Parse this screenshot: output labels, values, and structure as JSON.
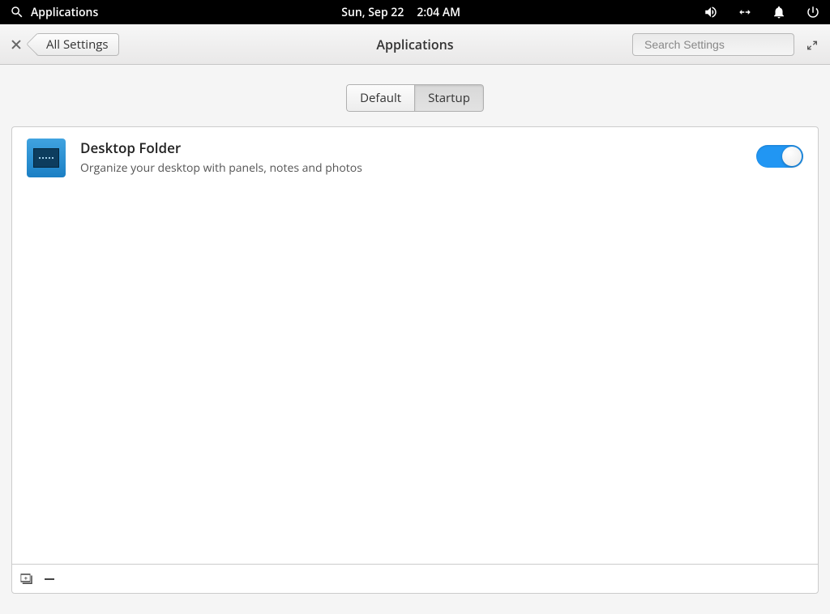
{
  "system_panel": {
    "apps_label": "Applications",
    "date": "Sun, Sep 22",
    "time": "2:04 AM"
  },
  "header": {
    "back_label": "All Settings",
    "title": "Applications",
    "search_placeholder": "Search Settings"
  },
  "tabs": {
    "default": "Default",
    "startup": "Startup",
    "active": "startup"
  },
  "apps": [
    {
      "title": "Desktop Folder",
      "desc": "Organize your desktop with panels, notes and photos",
      "enabled": true
    }
  ]
}
